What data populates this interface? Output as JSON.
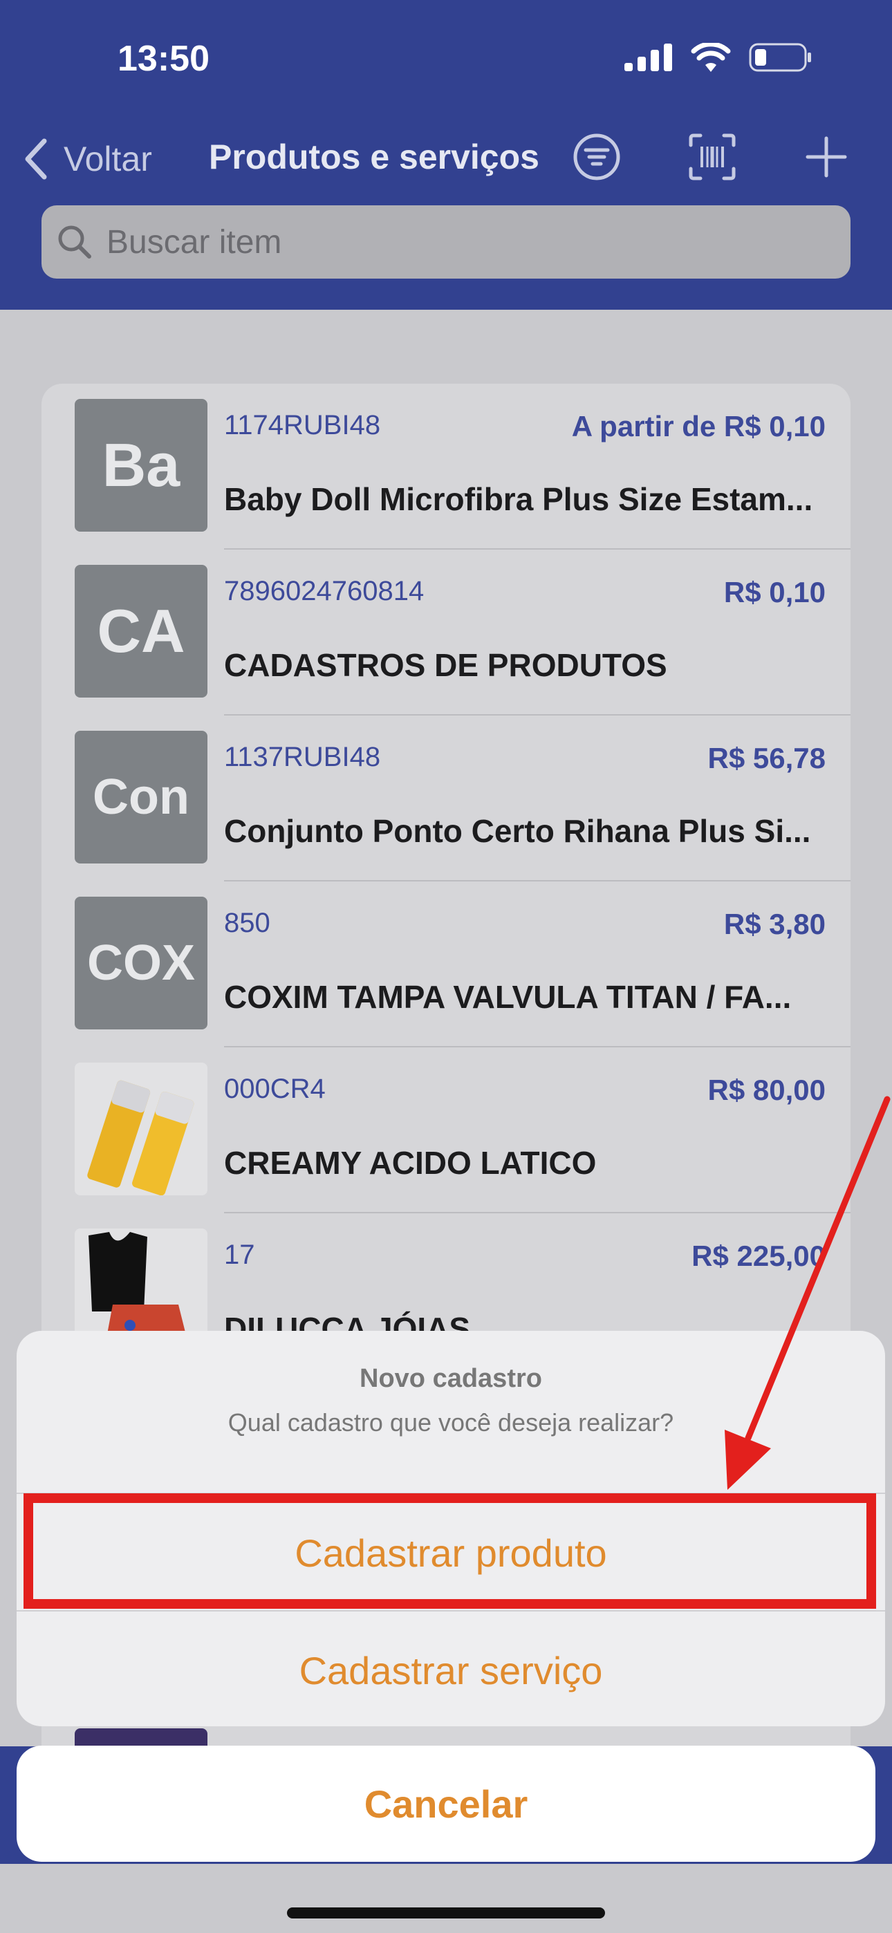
{
  "status_bar": {
    "time": "13:50"
  },
  "nav": {
    "back_label": "Voltar",
    "title": "Produtos e serviços"
  },
  "search": {
    "placeholder": "Buscar item"
  },
  "items": [
    {
      "initials": "Ba",
      "code": "1174RUBI48",
      "price": "A partir de R$ 0,10",
      "name": "Baby Doll Microfibra Plus Size Estam..."
    },
    {
      "initials": "CA",
      "code": "7896024760814",
      "price": "R$ 0,10",
      "name": "CADASTROS DE PRODUTOS"
    },
    {
      "initials": "Con",
      "code": "1137RUBI48",
      "price": "R$ 56,78",
      "name": "Conjunto Ponto Certo Rihana Plus Si..."
    },
    {
      "initials": "COX",
      "code": "850",
      "price": "R$ 3,80",
      "name": "COXIM TAMPA VALVULA TITAN / FA..."
    },
    {
      "initials": "",
      "code": "000CR4",
      "price": "R$ 80,00",
      "name": "CREAMY ACIDO LATICO"
    },
    {
      "initials": "",
      "code": "17",
      "price": "R$ 225,00",
      "name": "DILUCCA JÓIAS"
    }
  ],
  "action_sheet": {
    "title": "Novo cadastro",
    "message": "Qual cadastro que você deseja realizar?",
    "options": [
      "Cadastrar produto",
      "Cadastrar serviço"
    ],
    "cancel": "Cancelar"
  },
  "colors": {
    "header": "#324190",
    "accent": "#e08b2e",
    "highlight": "#e3201d",
    "link": "#3d4a9a"
  }
}
